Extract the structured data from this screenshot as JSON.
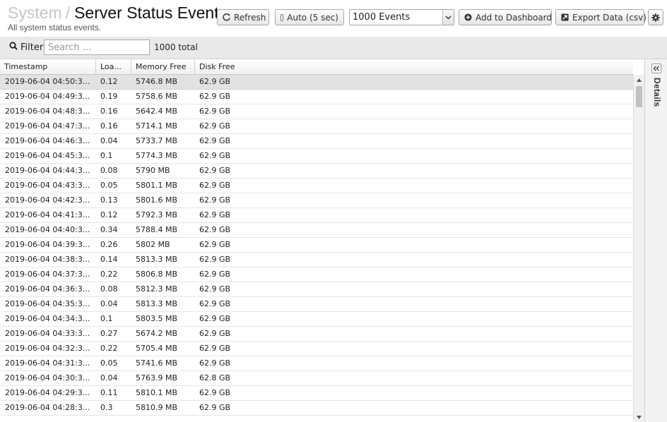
{
  "header": {
    "breadcrumb_root": "System",
    "breadcrumb_separator": "/",
    "title": "Server Status Events",
    "subtitle": "All system status events."
  },
  "toolbar": {
    "refresh_label": "Refresh",
    "auto_label": "Auto (5 sec)",
    "events_select_value": "1000 Events",
    "add_dashboard_label": "Add to Dashboard",
    "export_label": "Export Data (csv)"
  },
  "filter": {
    "label": "Filter",
    "placeholder": "Search ...",
    "total": "1000 total"
  },
  "table": {
    "columns": [
      "Timestamp",
      "Loa...",
      "Memory Free",
      "Disk Free"
    ],
    "rows": [
      {
        "ts": "2019-06-04 04:50:3...",
        "load": "0.12",
        "mem": "5746.8 MB",
        "disk": "62.9 GB"
      },
      {
        "ts": "2019-06-04 04:49:3...",
        "load": "0.19",
        "mem": "5758.6 MB",
        "disk": "62.9 GB"
      },
      {
        "ts": "2019-06-04 04:48:3...",
        "load": "0.16",
        "mem": "5642.4 MB",
        "disk": "62.9 GB"
      },
      {
        "ts": "2019-06-04 04:47:3...",
        "load": "0.16",
        "mem": "5714.1 MB",
        "disk": "62.9 GB"
      },
      {
        "ts": "2019-06-04 04:46:3...",
        "load": "0.04",
        "mem": "5733.7 MB",
        "disk": "62.9 GB"
      },
      {
        "ts": "2019-06-04 04:45:3...",
        "load": "0.1",
        "mem": "5774.3 MB",
        "disk": "62.9 GB"
      },
      {
        "ts": "2019-06-04 04:44:3...",
        "load": "0.08",
        "mem": "5790 MB",
        "disk": "62.9 GB"
      },
      {
        "ts": "2019-06-04 04:43:3...",
        "load": "0.05",
        "mem": "5801.1 MB",
        "disk": "62.9 GB"
      },
      {
        "ts": "2019-06-04 04:42:3...",
        "load": "0.13",
        "mem": "5801.6 MB",
        "disk": "62.9 GB"
      },
      {
        "ts": "2019-06-04 04:41:3...",
        "load": "0.12",
        "mem": "5792.3 MB",
        "disk": "62.9 GB"
      },
      {
        "ts": "2019-06-04 04:40:3...",
        "load": "0.34",
        "mem": "5788.4 MB",
        "disk": "62.9 GB"
      },
      {
        "ts": "2019-06-04 04:39:3...",
        "load": "0.26",
        "mem": "5802 MB",
        "disk": "62.9 GB"
      },
      {
        "ts": "2019-06-04 04:38:3...",
        "load": "0.14",
        "mem": "5813.3 MB",
        "disk": "62.9 GB"
      },
      {
        "ts": "2019-06-04 04:37:3...",
        "load": "0.22",
        "mem": "5806.8 MB",
        "disk": "62.9 GB"
      },
      {
        "ts": "2019-06-04 04:36:3...",
        "load": "0.08",
        "mem": "5812.3 MB",
        "disk": "62.9 GB"
      },
      {
        "ts": "2019-06-04 04:35:3...",
        "load": "0.04",
        "mem": "5813.3 MB",
        "disk": "62.9 GB"
      },
      {
        "ts": "2019-06-04 04:34:3...",
        "load": "0.1",
        "mem": "5803.5 MB",
        "disk": "62.9 GB"
      },
      {
        "ts": "2019-06-04 04:33:3...",
        "load": "0.27",
        "mem": "5674.2 MB",
        "disk": "62.9 GB"
      },
      {
        "ts": "2019-06-04 04:32:3...",
        "load": "0.22",
        "mem": "5705.4 MB",
        "disk": "62.9 GB"
      },
      {
        "ts": "2019-06-04 04:31:3...",
        "load": "0.05",
        "mem": "5741.6 MB",
        "disk": "62.9 GB"
      },
      {
        "ts": "2019-06-04 04:30:3...",
        "load": "0.04",
        "mem": "5763.9 MB",
        "disk": "62.8 GB"
      },
      {
        "ts": "2019-06-04 04:29:3...",
        "load": "0.11",
        "mem": "5810.1 MB",
        "disk": "62.9 GB"
      },
      {
        "ts": "2019-06-04 04:28:3...",
        "load": "0.3",
        "mem": "5810.9 MB",
        "disk": "62.9 GB"
      }
    ]
  },
  "details_panel": {
    "label": "Details"
  },
  "icons": {
    "refresh": "refresh-icon",
    "add": "plus-circle-icon",
    "export": "export-icon",
    "gear": "gear-icon",
    "search": "search-icon",
    "collapse": "double-chevron-left-icon"
  }
}
